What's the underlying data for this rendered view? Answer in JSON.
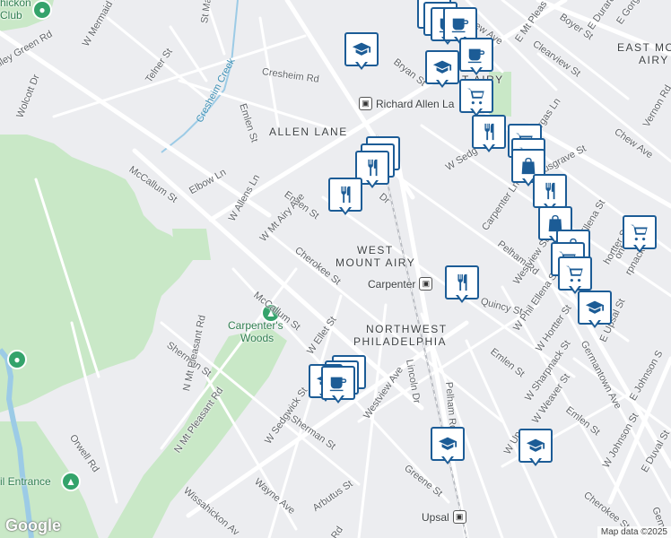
{
  "map": {
    "colors": {
      "park": "#c9e8c7",
      "road": "#ffffff",
      "water": "#9ccbe6",
      "marker": "#1c5c96",
      "background": "#ecedf0"
    },
    "top_left_labels": {
      "hickory": "hickon",
      "club": "Club"
    },
    "areas": {
      "allen_lane": "ALLEN LANE",
      "west_mount_airy_1": "WEST",
      "west_mount_airy_2": "MOUNT AIRY",
      "northwest_1": "NORTHWEST",
      "northwest_2": "PHILADELPHIA",
      "east_mount_airy_1": "EAST MOUNT",
      "east_mount_airy_2": "AIRY",
      "mt_airy_partial": "T AIRY"
    },
    "parks": {
      "carpenters_woods_1": "Carpenter's",
      "carpenters_woods_2": "Woods",
      "entrance": "il Entrance"
    },
    "creek": "Cresheim Creek",
    "stations": {
      "richard_allen_lane": "Richard Allen La",
      "carpenter": "Carpenter",
      "upsal": "Upsal"
    },
    "streets": {
      "valley_green": "alley Green Rd",
      "w_mermaid": "W Mermaid Ln",
      "st_martins": "St Ma",
      "telner": "Telner St",
      "wolcott": "Wolcott Dr",
      "emlen_1": "Emlen St",
      "emlen_2": "Emlen St",
      "emlen_3": "Emlen St",
      "emlen_4": "Emlen St",
      "cresheim_rd": "Cresheim Rd",
      "mccallum_1": "McCallum St",
      "mccallum_2": "McCallum St",
      "elbow": "Elbow Ln",
      "w_allens": "W Allens Ln",
      "w_mt_airy": "W Mt Airy Ave",
      "cherokee_1": "Cherokee St",
      "cherokee_2": "Cherokee St",
      "sherman_1": "Sherman St",
      "sherman_2": "Sherman St",
      "w_ellet": "W Ellet St",
      "w_sedgwick_1": "W Sedgwick St",
      "w_sedgwick_2": "W Sedg",
      "n_mt_pleasant": "N Mt Pleasant Rd",
      "orwell": "Orwell Rd",
      "wayne": "Wayne Ave",
      "wissahickon": "Wissahickon Av",
      "westview_1": "Westview Ave",
      "westview_2": "Westview St",
      "lincoln": "Lincoln Dr",
      "pelham_1": "Pelham Rd",
      "pelham_2": "Pelham Rd",
      "greene": "Greene St",
      "arbutus": "Arbutus St",
      "quincy": "Quincy St",
      "bryan": "Bryan St",
      "carpenter_ln": "Carpenter Ln",
      "musgrave": "Musgrave St",
      "chew_1": "Chew Ave",
      "chew_2": "hew Ave",
      "clearview": "Clearview St",
      "boyer": "Boyer St",
      "e_durard": "E Durard St",
      "e_gorgas_1": "E Gorgas",
      "gorgas_ln": "orgas Ln",
      "e_mt_pleasant": "E Mt Pleas",
      "vernon": "Vernon Rd",
      "w_phil_ellena": "W Phil Ellena St",
      "ellena": "Ellena St",
      "w_hortter_1": "W Hortter St",
      "hortter_2": "hortter St",
      "w_sharpnack": "W Sharpnack St",
      "sharpnack_2": "rpnack St",
      "w_weaver": "W Weaver St",
      "w_johnson": "W Johnson St",
      "e_johnson": "E Johnson S",
      "e_upsal": "E Upsal St",
      "germantown": "Germantown Ave",
      "e_duval": "E Duval St",
      "montana": "ontana St",
      "w_up": "W Up",
      "germ_2": "Gem",
      "mt_airy_ave_2": "Dr",
      "rd_bottom": "Rd"
    },
    "attribution": "Map data ©2025",
    "logo": "Google"
  }
}
